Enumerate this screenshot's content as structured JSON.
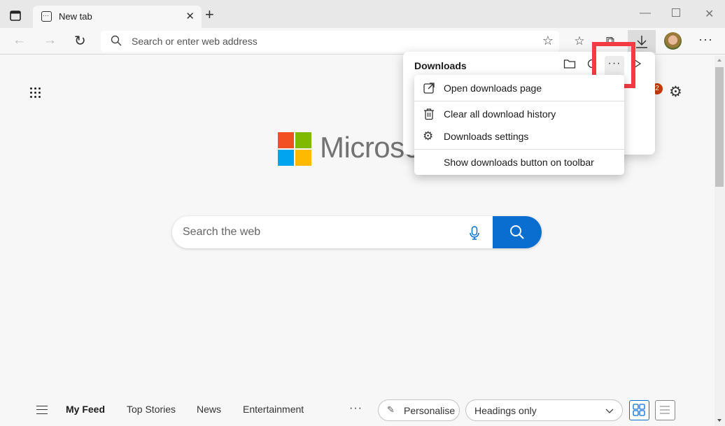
{
  "browser": {
    "tab": {
      "title": "New tab"
    },
    "address_bar": {
      "placeholder": "Search or enter web address"
    },
    "window_controls": [
      "minimize",
      "maximize",
      "close"
    ]
  },
  "downloads_panel": {
    "title": "Downloads",
    "icons": [
      "folder-icon",
      "search-icon",
      "more-icon",
      "pin-icon"
    ]
  },
  "context_menu": {
    "items": [
      {
        "label": "Open downloads page",
        "icon": "external-link-icon"
      },
      {
        "label": "Clear all download history",
        "icon": "trash-icon"
      },
      {
        "label": "Downloads settings",
        "icon": "gear-icon"
      },
      {
        "label": "Show downloads button on toolbar",
        "icon": ""
      }
    ]
  },
  "new_tab_page": {
    "logo_text": "Microsoft",
    "notification_count": "2",
    "search": {
      "placeholder": "Search the web"
    },
    "feed": {
      "tabs": [
        "My Feed",
        "Top Stories",
        "News",
        "Entertainment"
      ],
      "active_tab": "My Feed",
      "more_label": "···",
      "personalise_label": "Personalise",
      "layout_select": "Headings only"
    }
  },
  "colors": {
    "accent": "#0a6ed1",
    "highlight": "#f23b43",
    "badge": "#c83c00",
    "ms_red": "#f25022",
    "ms_green": "#7fba00",
    "ms_blue": "#00a4ef",
    "ms_yellow": "#ffb900"
  }
}
